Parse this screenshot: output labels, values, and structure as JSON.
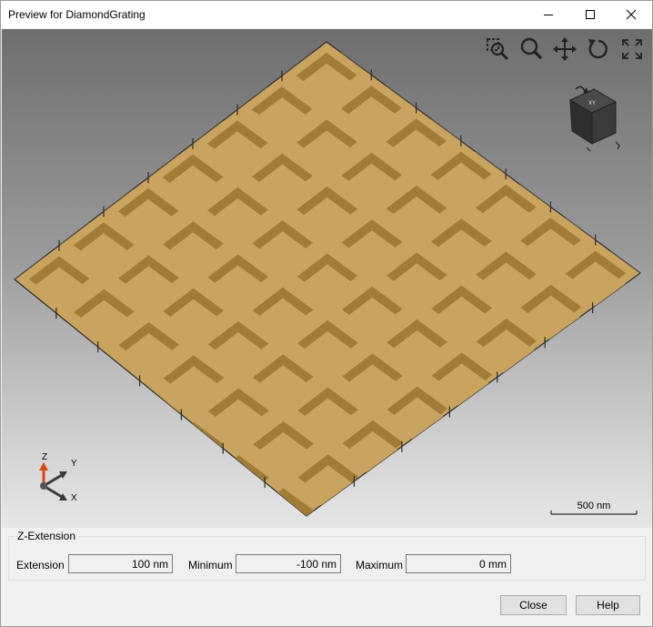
{
  "window": {
    "title": "Preview for DiamondGrating"
  },
  "titlebar_buttons": {
    "minimize": "minimize-icon",
    "maximize": "maximize-icon",
    "close": "close-icon"
  },
  "viewport": {
    "toolbar": [
      "zoom-region-icon",
      "zoom-icon",
      "pan-icon",
      "rotate-icon",
      "fit-view-icon"
    ],
    "scale_bar": {
      "label": "500 nm"
    },
    "axes": {
      "z": "Z",
      "y": "Y",
      "x": "X"
    },
    "colors": {
      "surface": "#c9a460",
      "surface_dark": "#a07c36",
      "outline": "#2a2a2a",
      "z_axis": "#d9480f"
    }
  },
  "z_extension": {
    "legend": "Z-Extension",
    "extension_label": "Extension",
    "extension_value": "100 nm",
    "minimum_label": "Minimum",
    "minimum_value": "-100 nm",
    "maximum_label": "Maximum",
    "maximum_value": "0 mm"
  },
  "buttons": {
    "close": "Close",
    "help": "Help"
  }
}
